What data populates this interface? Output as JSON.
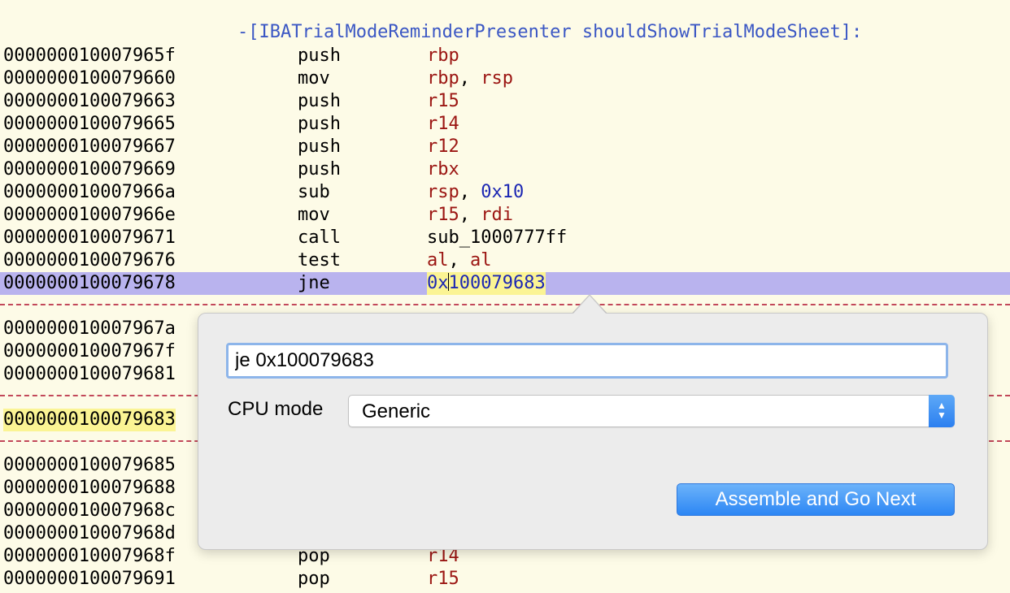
{
  "procedure_title": "-[IBATrialModeReminderPresenter shouldShowTrialModeSheet]:",
  "rows": [
    {
      "addr": "000000010007965f",
      "mnem": "push",
      "ops": [
        {
          "t": "rbp",
          "c": "reg"
        }
      ]
    },
    {
      "addr": "0000000100079660",
      "mnem": "mov",
      "ops": [
        {
          "t": "rbp",
          "c": "reg"
        },
        {
          "t": ", ",
          "c": "sep"
        },
        {
          "t": "rsp",
          "c": "reg"
        }
      ]
    },
    {
      "addr": "0000000100079663",
      "mnem": "push",
      "ops": [
        {
          "t": "r15",
          "c": "reg"
        }
      ]
    },
    {
      "addr": "0000000100079665",
      "mnem": "push",
      "ops": [
        {
          "t": "r14",
          "c": "reg"
        }
      ]
    },
    {
      "addr": "0000000100079667",
      "mnem": "push",
      "ops": [
        {
          "t": "r12",
          "c": "reg"
        }
      ]
    },
    {
      "addr": "0000000100079669",
      "mnem": "push",
      "ops": [
        {
          "t": "rbx",
          "c": "reg"
        }
      ]
    },
    {
      "addr": "000000010007966a",
      "mnem": "sub",
      "ops": [
        {
          "t": "rsp",
          "c": "reg"
        },
        {
          "t": ", ",
          "c": "sep"
        },
        {
          "t": "0x10",
          "c": "imm"
        }
      ]
    },
    {
      "addr": "000000010007966e",
      "mnem": "mov",
      "ops": [
        {
          "t": "r15",
          "c": "reg"
        },
        {
          "t": ", ",
          "c": "sep"
        },
        {
          "t": "rdi",
          "c": "reg"
        }
      ]
    },
    {
      "addr": "0000000100079671",
      "mnem": "call",
      "ops": [
        {
          "t": "sub_1000777ff",
          "c": "sym"
        }
      ]
    },
    {
      "addr": "0000000100079676",
      "mnem": "test",
      "ops": [
        {
          "t": "al",
          "c": "reg"
        },
        {
          "t": ", ",
          "c": "sep"
        },
        {
          "t": "al",
          "c": "reg"
        }
      ]
    },
    {
      "addr": "0000000100079678",
      "mnem": "jne",
      "selected": true,
      "ops": [
        {
          "t": "0x",
          "c": "imm"
        },
        {
          "caret": true
        },
        {
          "t": "100079683",
          "c": "imm"
        }
      ],
      "ops_highlight": true
    }
  ],
  "rows_after_sep1": [
    {
      "addr": "000000010007967a",
      "mnem": "",
      "ops": []
    },
    {
      "addr": "000000010007967f",
      "mnem": "",
      "ops": []
    },
    {
      "addr": "0000000100079681",
      "mnem": "",
      "ops": []
    }
  ],
  "label_row": {
    "addr": "0000000100079683"
  },
  "rows_after_sep3": [
    {
      "addr": "0000000100079685",
      "mnem": "",
      "ops": []
    },
    {
      "addr": "0000000100079688",
      "mnem": "",
      "ops": []
    },
    {
      "addr": "000000010007968c",
      "mnem": "",
      "ops": []
    },
    {
      "addr": "000000010007968d",
      "mnem": "",
      "ops": []
    },
    {
      "addr": "000000010007968f",
      "mnem": "pop",
      "ops": [
        {
          "t": "r14",
          "c": "reg"
        }
      ]
    },
    {
      "addr": "0000000100079691",
      "mnem": "pop",
      "ops": [
        {
          "t": "r15",
          "c": "reg"
        }
      ]
    }
  ],
  "assemble_popover": {
    "instruction_value": "je 0x100079683",
    "cpu_mode_label": "CPU mode",
    "cpu_mode_value": "Generic",
    "assemble_button_label": "Assemble and Go Next"
  },
  "colors": {
    "background": "#fdfbe7",
    "selection": "#b9b3ee",
    "highlight": "#fbf494",
    "register": "#9b1512",
    "immediate": "#1c27b3",
    "procedure_title": "#3b57c4",
    "separator": "#c2485a",
    "accent_button": "#2c86f4"
  }
}
